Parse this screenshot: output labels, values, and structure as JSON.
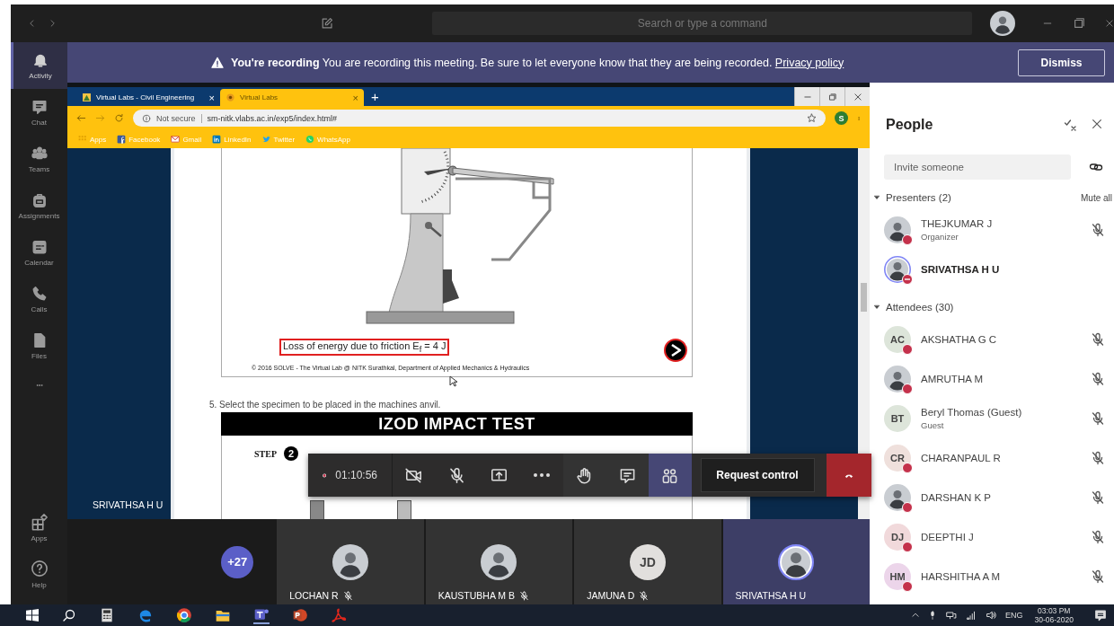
{
  "title_bar": {
    "search_placeholder": "Search or type a command"
  },
  "rail": [
    {
      "label": "Activity",
      "selected": true
    },
    {
      "label": "Chat",
      "selected": false
    },
    {
      "label": "Teams",
      "selected": false
    },
    {
      "label": "Assignments",
      "selected": false
    },
    {
      "label": "Calendar",
      "selected": false
    },
    {
      "label": "Calls",
      "selected": false
    },
    {
      "label": "Files",
      "selected": false
    }
  ],
  "rail_bottom": [
    {
      "label": "Apps"
    },
    {
      "label": "Help"
    }
  ],
  "banner": {
    "text": "**You're recording** You are recording this meeting. Be sure to let everyone know that they are being recorded.",
    "link": "Privacy policy",
    "button": "Dismiss"
  },
  "browser": {
    "tabs": [
      {
        "title": "Virtual Labs - Civil Engineering",
        "close": "×",
        "selected": false
      },
      {
        "title": "Virtual Labs",
        "close": "×",
        "selected": true
      }
    ],
    "new_tab": "+",
    "security": "Not secure",
    "url": "sm-nitk.vlabs.ac.in/exp5/index.html#",
    "profile": "S",
    "bookmarks": [
      {
        "label": "Apps"
      },
      {
        "label": "Facebook"
      },
      {
        "label": "Gmail"
      },
      {
        "label": "LinkedIn"
      },
      {
        "label": "Twitter"
      },
      {
        "label": "WhatsApp"
      }
    ]
  },
  "page": {
    "friction_label": "Loss of energy due to friction E$_{f}$ = 4 J",
    "copyright": "© 2016 SOLVE - The Virtual Lab @ NITK Surathkal, Department of Applied Mechanics & Hydraulics",
    "instruction": "5. Select the specimen to be placed in the machines anvil.",
    "test_title": "IZOD IMPACT TEST",
    "step_label": "STEP",
    "step_number": "2"
  },
  "presenter_label": "SRIVATHSA H U",
  "call_controls": {
    "recording": true,
    "timer": "01:10:56",
    "buttons": [
      {
        "kind": "camera",
        "selected": false
      },
      {
        "kind": "mic",
        "selected": false
      },
      {
        "kind": "share",
        "selected": false
      },
      {
        "kind": "more",
        "selected": false
      },
      {
        "kind": "hand",
        "selected": false
      },
      {
        "kind": "chat",
        "selected": false
      },
      {
        "kind": "people",
        "selected": true
      }
    ],
    "request_control": "Request control"
  },
  "video_strip": {
    "overflow_count": "+27",
    "tiles": [
      {
        "name": "LOCHAN R",
        "kind": "photo",
        "muted": true,
        "selected": false
      },
      {
        "name": "KAUSTUBHA M B",
        "kind": "photo",
        "muted": true,
        "selected": false
      },
      {
        "name": "JAMUNA D",
        "kind": "initials",
        "initials": "JD",
        "muted": true,
        "selected": false
      },
      {
        "name": "SRIVATHSA H U",
        "kind": "photo",
        "muted": false,
        "selected": true
      }
    ]
  },
  "people": {
    "title": "People",
    "invite_placeholder": "Invite someone",
    "sections": [
      {
        "title": "Presenters (2)",
        "expanded": true,
        "action": "Mute all",
        "members": [
          {
            "name": "THEJKUMAR J",
            "role": "Organizer",
            "kind": "photo",
            "busy": true,
            "do_not_disturb": false,
            "muted": true,
            "selected": false
          },
          {
            "name": "SRIVATHSA H U",
            "kind": "photo",
            "busy": false,
            "do_not_disturb": true,
            "muted": false,
            "selected": true
          }
        ]
      },
      {
        "title": "Attendees (30)",
        "expanded": true,
        "members": [
          {
            "name": "AKSHATHA G C",
            "kind": "initials",
            "initials": "AC",
            "color": "#dde5da",
            "busy": true,
            "do_not_disturb": false,
            "muted": true,
            "selected": false
          },
          {
            "name": "AMRUTHA M",
            "kind": "photo",
            "busy": true,
            "do_not_disturb": false,
            "muted": true,
            "selected": false
          },
          {
            "name": "Beryl Thomas (Guest)",
            "role": "Guest",
            "kind": "initials",
            "initials": "BT",
            "color": "#dde5da",
            "busy": false,
            "do_not_disturb": false,
            "muted": true,
            "selected": false
          },
          {
            "name": "CHARANPAUL R",
            "kind": "initials",
            "initials": "CR",
            "color": "#efe0dc",
            "busy": true,
            "do_not_disturb": false,
            "muted": true,
            "selected": false
          },
          {
            "name": "DARSHAN K P",
            "kind": "photo",
            "busy": true,
            "do_not_disturb": false,
            "muted": true,
            "selected": false
          },
          {
            "name": "DEEPTHI J",
            "kind": "initials",
            "initials": "DJ",
            "color": "#f1d9db",
            "busy": true,
            "do_not_disturb": false,
            "muted": true,
            "selected": false
          },
          {
            "name": "HARSHITHA A M",
            "kind": "initials",
            "initials": "HM",
            "color": "#ecd5ea",
            "busy": true,
            "do_not_disturb": false,
            "muted": true,
            "selected": false
          }
        ]
      }
    ]
  },
  "taskbar": {
    "language": "ENG",
    "time": "03:03 PM",
    "date": "30-06-2020"
  }
}
